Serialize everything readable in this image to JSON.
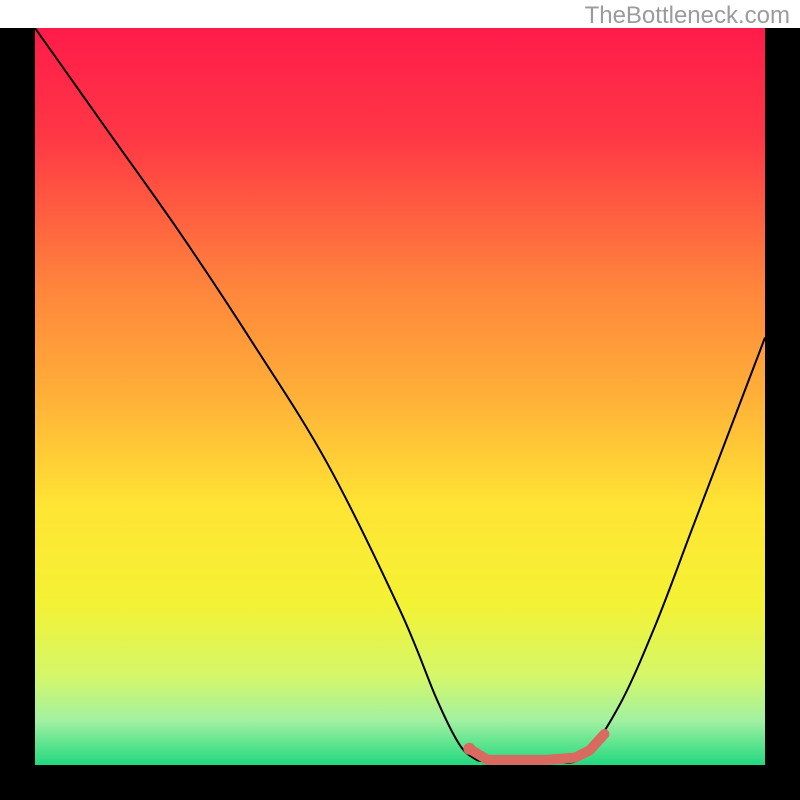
{
  "watermark": "TheBottleneck.com",
  "chart_data": {
    "type": "line",
    "title": "",
    "xlabel": "",
    "ylabel": "",
    "xlim": [
      0,
      100
    ],
    "ylim": [
      0,
      100
    ],
    "background_gradient": {
      "stops": [
        {
          "offset": 0,
          "color": "#ff1b4a"
        },
        {
          "offset": 15,
          "color": "#ff3845"
        },
        {
          "offset": 35,
          "color": "#ff843c"
        },
        {
          "offset": 50,
          "color": "#ffb038"
        },
        {
          "offset": 65,
          "color": "#ffe534"
        },
        {
          "offset": 78,
          "color": "#f4f234"
        },
        {
          "offset": 88,
          "color": "#d4f76a"
        },
        {
          "offset": 94,
          "color": "#a1f1a1"
        },
        {
          "offset": 100,
          "color": "#21d87f"
        }
      ]
    },
    "series": [
      {
        "name": "bottleneck-curve",
        "type": "spline",
        "color": "#000000",
        "width": 2,
        "x": [
          0,
          5,
          10,
          20,
          30,
          40,
          50,
          55,
          58,
          60,
          62,
          70,
          75,
          80,
          85,
          90,
          95,
          100
        ],
        "y": [
          100,
          93,
          86,
          72,
          57,
          41,
          21,
          9,
          3,
          1,
          0.5,
          0.5,
          1,
          8,
          19,
          32,
          45,
          58
        ]
      },
      {
        "name": "highlight-segment",
        "type": "line",
        "color": "#d86a60",
        "width": 10,
        "linecap": "round",
        "x": [
          59.5,
          62,
          70,
          74,
          76,
          78
        ],
        "y": [
          2.2,
          0.7,
          0.7,
          1.0,
          2.0,
          4.2
        ]
      }
    ],
    "markers": [
      {
        "name": "highlight-dot",
        "x": 59.5,
        "y": 2.2,
        "r": 6,
        "color": "#d86a60"
      }
    ]
  }
}
